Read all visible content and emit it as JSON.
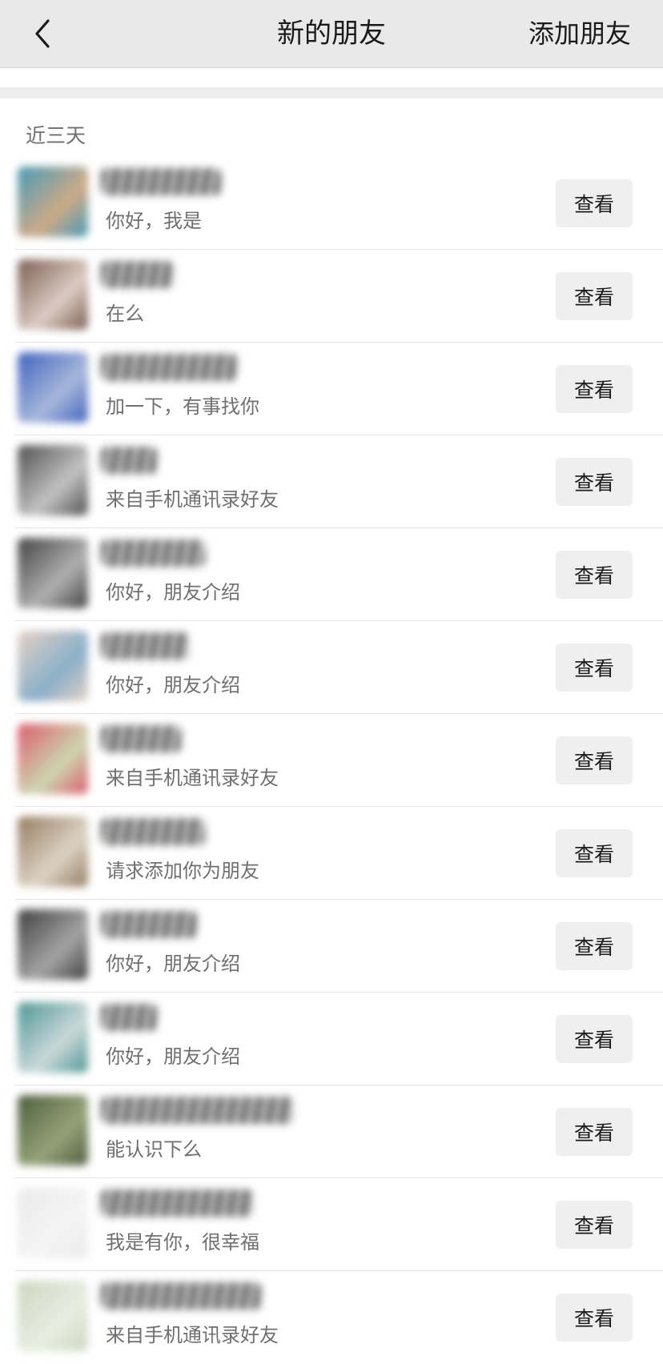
{
  "navbar": {
    "back_icon": "chevron-left-icon",
    "title": "新的朋友",
    "action_label": "添加朋友"
  },
  "section": {
    "header": "近三天"
  },
  "requests": [
    {
      "message": "你好，我是",
      "button_label": "查看",
      "avatar_colors": [
        "#2f8fb0",
        "#c9a27a"
      ]
    },
    {
      "message": "在么",
      "button_label": "查看",
      "avatar_colors": [
        "#6b4a3e",
        "#d9c8be"
      ]
    },
    {
      "message": "加一下，有事找你",
      "button_label": "查看",
      "avatar_colors": [
        "#2a52b8",
        "#9fb0d8"
      ]
    },
    {
      "message": "来自手机通讯录好友",
      "button_label": "查看",
      "avatar_colors": [
        "#3c3c3c",
        "#bdbdbd"
      ]
    },
    {
      "message": "你好，朋友介绍",
      "button_label": "查看",
      "avatar_colors": [
        "#2e2e2e",
        "#a8a8a8"
      ]
    },
    {
      "message": "你好，朋友介绍",
      "button_label": "查看",
      "avatar_colors": [
        "#e3cdbf",
        "#7fa7c4"
      ]
    },
    {
      "message": "来自手机通讯录好友",
      "button_label": "查看",
      "avatar_colors": [
        "#d94a5c",
        "#c8d2a8"
      ]
    },
    {
      "message": "请求添加你为朋友",
      "button_label": "查看",
      "avatar_colors": [
        "#8a6d4e",
        "#d9cfc0"
      ]
    },
    {
      "message": "你好，朋友介绍",
      "button_label": "查看",
      "avatar_colors": [
        "#2b2b2b",
        "#9a9a9a"
      ]
    },
    {
      "message": "你好，朋友介绍",
      "button_label": "查看",
      "avatar_colors": [
        "#3d8a8a",
        "#c6d6d6"
      ]
    },
    {
      "message": "能认识下么",
      "button_label": "查看",
      "avatar_colors": [
        "#3b4a2a",
        "#8a9a6a"
      ]
    },
    {
      "message": "我是有你，很幸福",
      "button_label": "查看",
      "avatar_colors": [
        "#e8e8e8",
        "#f4f4f4"
      ]
    },
    {
      "message": "来自手机通讯录好友",
      "button_label": "查看",
      "avatar_colors": [
        "#c8d2b8",
        "#e6ece0"
      ]
    }
  ]
}
